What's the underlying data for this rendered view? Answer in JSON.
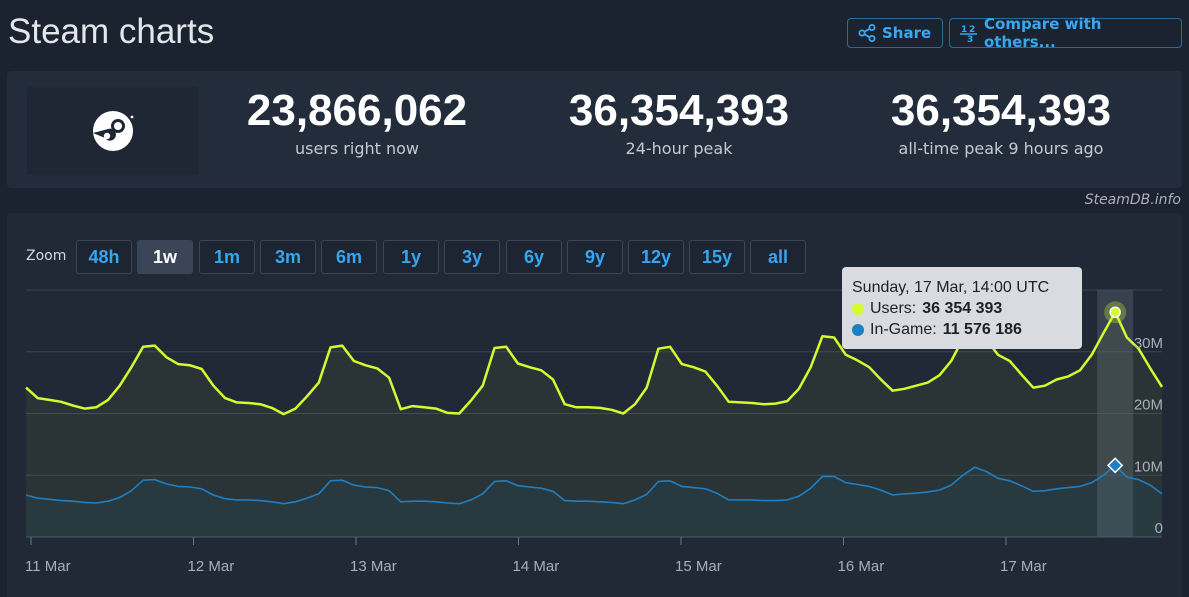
{
  "page": {
    "title": "Steam charts",
    "credit": "SteamDB.info"
  },
  "toolbar": {
    "share_label": "Share",
    "compare_label": "Compare with others..."
  },
  "stats": [
    {
      "value": "23,866,062",
      "label": "users right now"
    },
    {
      "value": "36,354,393",
      "label": "24-hour peak"
    },
    {
      "value": "36,354,393",
      "label": "all-time peak 9 hours ago"
    }
  ],
  "zoom": {
    "label": "Zoom",
    "options": [
      "48h",
      "1w",
      "1m",
      "3m",
      "6m",
      "1y",
      "3y",
      "6y",
      "9y",
      "12y",
      "15y",
      "all"
    ],
    "active": "1w"
  },
  "tooltip": {
    "date": "Sunday, 17 Mar, 14:00 UTC",
    "users_label": "Users:",
    "users_value": "36 354 393",
    "ingame_label": "In-Game:",
    "ingame_value": "11 576 186"
  },
  "colors": {
    "users": "#d6f92f",
    "ingame": "#1e7fc4",
    "accent": "#38a8f2"
  },
  "chart_data": {
    "type": "line",
    "x_tick_labels": [
      "11 Mar",
      "12 Mar",
      "13 Mar",
      "14 Mar",
      "15 Mar",
      "16 Mar",
      "17 Mar"
    ],
    "y_tick_labels": [
      "0",
      "10M",
      "20M",
      "30M"
    ],
    "ylim": [
      0,
      40000000
    ],
    "grid": true,
    "hours_per_point": 2,
    "series": [
      {
        "name": "Users",
        "values": [
          24.2,
          22.5,
          22.2,
          21.9,
          21.3,
          20.8,
          21.0,
          22.2,
          24.5,
          27.5,
          30.8,
          31.0,
          29.1,
          28.0,
          27.8,
          27.2,
          24.5,
          22.5,
          21.8,
          21.7,
          21.5,
          20.9,
          19.9,
          20.8,
          22.8,
          25.0,
          30.7,
          31.0,
          28.5,
          27.8,
          27.3,
          25.8,
          20.7,
          21.2,
          21.0,
          20.8,
          20.1,
          20.0,
          22.1,
          24.5,
          30.6,
          30.8,
          28.1,
          27.5,
          27.0,
          25.5,
          21.5,
          21.0,
          21.0,
          20.9,
          20.6,
          20.0,
          21.5,
          24.2,
          30.5,
          30.8,
          28.0,
          27.5,
          26.8,
          24.5,
          21.9,
          21.8,
          21.7,
          21.5,
          21.6,
          22.0,
          24.0,
          27.5,
          32.5,
          32.3,
          29.5,
          28.6,
          27.5,
          25.5,
          23.7,
          24.0,
          24.5,
          25.0,
          26.2,
          28.5,
          32.1,
          33.6,
          32.0,
          29.5,
          28.5,
          26.3,
          24.2,
          24.5,
          25.5,
          26.0,
          27.0,
          29.5,
          33.0,
          36.4,
          32.3,
          30.5,
          27.3,
          24.3
        ]
      },
      {
        "name": "In-Game",
        "values": [
          6.8,
          6.3,
          6.1,
          5.9,
          5.8,
          5.6,
          5.5,
          5.8,
          6.4,
          7.5,
          9.2,
          9.3,
          8.6,
          8.2,
          8.1,
          7.8,
          6.8,
          6.2,
          6.0,
          6.0,
          5.9,
          5.7,
          5.4,
          5.7,
          6.3,
          7.0,
          9.1,
          9.2,
          8.4,
          8.1,
          8.0,
          7.5,
          5.7,
          5.8,
          5.8,
          5.7,
          5.5,
          5.4,
          6.0,
          7.0,
          9.0,
          9.1,
          8.3,
          8.1,
          7.9,
          7.4,
          5.9,
          5.8,
          5.8,
          5.7,
          5.6,
          5.4,
          6.0,
          6.9,
          9.0,
          9.1,
          8.2,
          8.0,
          7.8,
          7.1,
          6.0,
          6.0,
          6.0,
          5.9,
          5.9,
          6.0,
          6.6,
          7.9,
          9.8,
          9.8,
          8.8,
          8.5,
          8.2,
          7.6,
          6.8,
          7.0,
          7.1,
          7.3,
          7.6,
          8.4,
          10.0,
          11.3,
          10.6,
          9.5,
          9.1,
          8.3,
          7.4,
          7.5,
          7.8,
          8.0,
          8.2,
          8.8,
          10.0,
          11.6,
          9.7,
          9.3,
          8.4,
          7.0
        ]
      }
    ],
    "highlight": {
      "series": "Users",
      "index": 93
    }
  }
}
